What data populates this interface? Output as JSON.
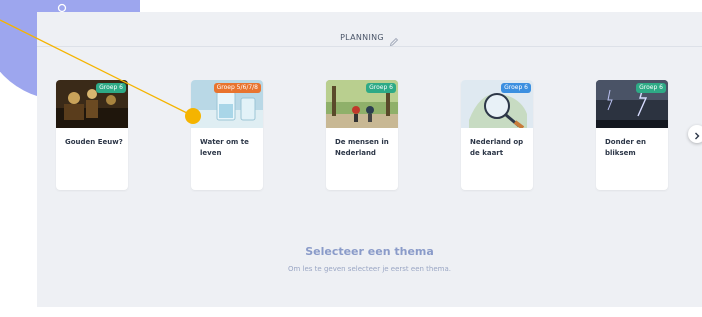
{
  "header": {
    "title": "PLANNING",
    "edit_icon": "pencil-icon"
  },
  "themes": [
    {
      "title": "Gouden Eeuw?",
      "badge": "Groep 6",
      "badge_color": "#2eaa86"
    },
    {
      "title": "Water om te leven",
      "badge": "Groep 5/6/7/8",
      "badge_color": "#e8742f"
    },
    {
      "title": "De mensen in Nederland",
      "badge": "Groep 6",
      "badge_color": "#2eaa86"
    },
    {
      "title": "Nederland op de kaart",
      "badge": "Groep 6",
      "badge_color": "#3b8fe0"
    },
    {
      "title": "Donder en bliksem",
      "badge": "Groep 6",
      "badge_color": "#2eaa86"
    }
  ],
  "carousel": {
    "next_icon": "chevron-right-icon"
  },
  "empty_state": {
    "title": "Selecteer een thema",
    "subtitle": "Om les te geven selecteer je eerst een thema."
  },
  "colors": {
    "panel": "#eef0f4",
    "blob": "#9da6ee",
    "pointer_line": "#f5b400",
    "empty_title": "#8a9bc9"
  }
}
